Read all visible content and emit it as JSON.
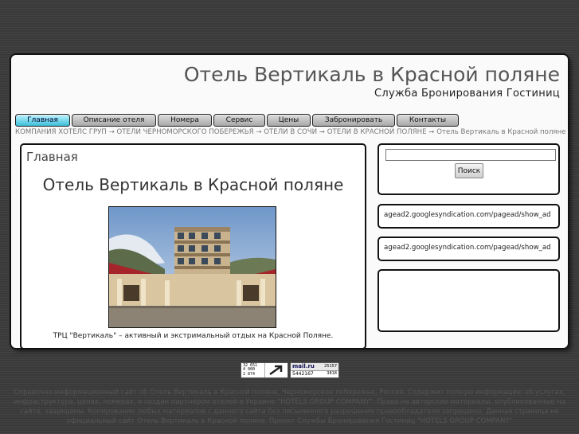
{
  "header": {
    "title": "Отель Вертикаль в Красной поляне",
    "subtitle": "Служба Бронирования Гостиниц"
  },
  "nav": {
    "items": [
      {
        "label": "Главная",
        "active": true
      },
      {
        "label": "Описание отеля"
      },
      {
        "label": "Номера"
      },
      {
        "label": "Сервис"
      },
      {
        "label": "Цены"
      },
      {
        "label": "Забронировать"
      },
      {
        "label": "Контакты"
      }
    ]
  },
  "breadcrumb": {
    "items": [
      "КОМПАНИЯ ХОТЕЛС ГРУП",
      "ОТЕЛИ ЧЕРНОМОРСКОГО ПОБЕРЕЖЬЯ",
      "ОТЕЛИ В СОЧИ",
      "ОТЕЛИ В КРАСНОЙ ПОЛЯНЕ",
      "Отель Вертикаль в Красной поляне"
    ],
    "separators": [
      " → ",
      " → ",
      " ➞ ",
      " ➞ "
    ]
  },
  "main": {
    "section_title": "Главная",
    "article_title": "Отель Вертикаль в Красной поляне",
    "caption": "ТРЦ \"Вертикаль\" – активный и экстримальный отдых на Красной Поляне."
  },
  "sidebar": {
    "search": {
      "value": "",
      "button_label": "Поиск"
    },
    "ads": [
      "agead2.googlesyndication.com/pagead/show_ad",
      "agead2.googlesyndication.com/pagead/show_ad"
    ]
  },
  "counters": {
    "a_lines": [
      "32 651",
      "4 000",
      "2 874"
    ],
    "b_brand": "mail.ru",
    "b_top": "25157",
    "b_bottom_left": "5442167",
    "b_bottom_right": "3818"
  },
  "footer": {
    "text": "Справочно-информационный сайт об Отель Вертикаль в Красной поляне, Черноморское побережье, Россия. Содержит полную информацию об услугах, инфраструктура, ценах, номерах, и создан партнером отелей в Украине \"HOTELS GROUP COMPANY\". Права на авторские материалы, опубликованные на сайте, защищены. Копирование любых материалов с данного сайта без письменного разрешения правообладателя запрещено. Данная страница не официальный сайт Отель Вертикаль в Красной поляне. Проект Службы Бронирования Гостиниц \"HOTELS GROUP COMPANY\""
  },
  "colors": {
    "page_bg": "#3a3a3a",
    "nav_active": "#3cbfd8",
    "nav_inactive": "#b8b8b8"
  }
}
